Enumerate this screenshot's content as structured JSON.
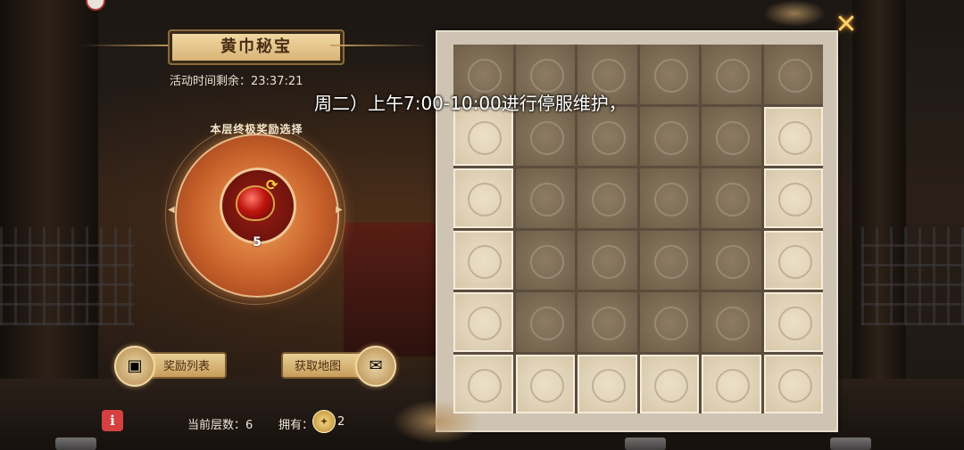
{
  "title": "黄巾秘宝",
  "timer": "活动时间剩余：23:37:21",
  "reward_section": {
    "label": "本层终极奖励选择",
    "item_count": "5"
  },
  "buttons": {
    "reward_list": "奖励列表",
    "get_map": "获取地图"
  },
  "footer": {
    "info_icon": "i",
    "current_layer": "当前层数：6",
    "own_label": "拥有：",
    "own_value": "2"
  },
  "notice": "周二）上午7:00-10:00进行停服维护，",
  "board": {
    "rows": 6,
    "cols": 6,
    "tiles": [
      "dark",
      "dark",
      "dark",
      "dark",
      "dark",
      "dark",
      "light",
      "dark",
      "dark",
      "dark",
      "dark",
      "light",
      "light",
      "dark",
      "dark",
      "dark",
      "dark",
      "light",
      "light",
      "dark",
      "dark",
      "dark",
      "dark",
      "light",
      "light",
      "dark",
      "dark",
      "dark",
      "dark",
      "light",
      "light",
      "light",
      "light",
      "light",
      "light",
      "light"
    ]
  },
  "icons": {
    "close": "close-icon",
    "refresh": "refresh-icon",
    "chest": "treasure-chest-icon",
    "map": "map-scroll-icon",
    "info": "info-icon",
    "map_token": "map-token-icon"
  },
  "colors": {
    "accent": "#ffd36a",
    "banner": "#e8cf97",
    "tile_dark": "#7d6b55",
    "tile_light": "#e2d4b8",
    "info_red": "#d64040"
  }
}
